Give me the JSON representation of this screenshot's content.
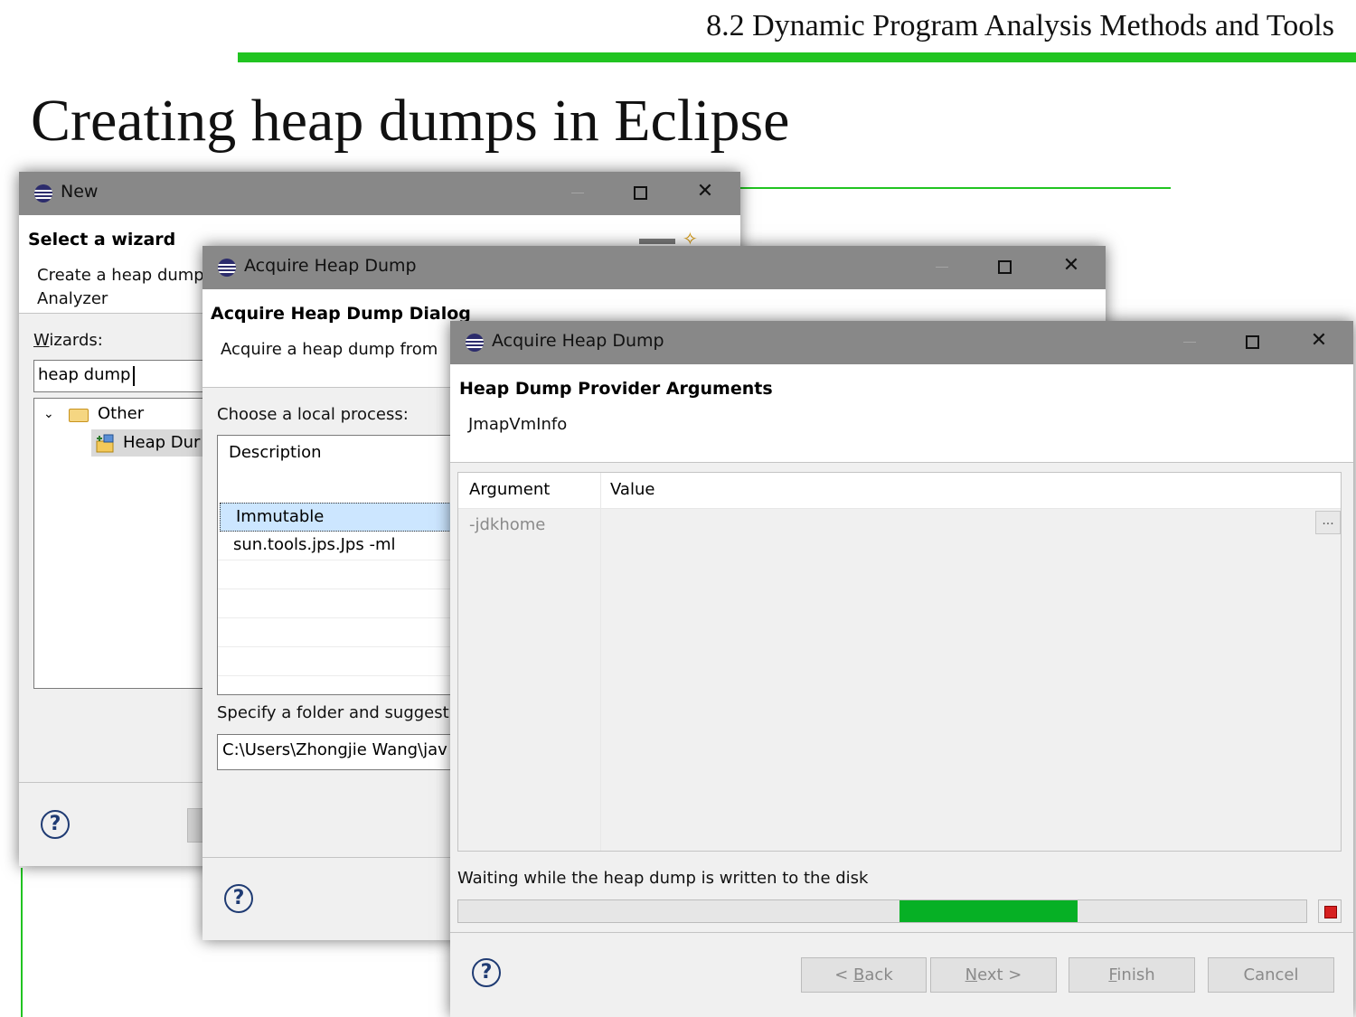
{
  "slide": {
    "section_header": "8.2 Dynamic Program Analysis Methods and Tools",
    "title": "Creating heap dumps in Eclipse"
  },
  "colors": {
    "accent_green": "#21c421",
    "titlebar": "#888888",
    "progress": "#06b025"
  },
  "new_window": {
    "title": "New",
    "heading": "Select a wizard",
    "description_line1": "Create a heap dump",
    "description_line2": "Analyzer",
    "wizards_label": "Wizards:",
    "filter_value": "heap dump",
    "tree": [
      {
        "label": "Other",
        "icon": "folder-icon",
        "expanded": true
      },
      {
        "label": "Heap Dur",
        "icon": "heap-dump-wizard-icon",
        "selected": true
      }
    ],
    "help_label": "?"
  },
  "acquire_window_1": {
    "title": "Acquire Heap Dump",
    "heading": "Acquire Heap Dump Dialog",
    "description": "Acquire a heap dump from",
    "choose_label": "Choose a local process:",
    "column_header": "Description",
    "processes": [
      {
        "label": "Immutable",
        "selected": true
      },
      {
        "label": "sun.tools.jps.Jps -ml",
        "selected": false
      }
    ],
    "folder_label": "Specify a folder and suggest",
    "folder_value": "C:\\Users\\Zhongjie Wang\\jav",
    "help_label": "?"
  },
  "acquire_window_2": {
    "title": "Acquire Heap Dump",
    "heading": "Heap Dump Provider Arguments",
    "provider": "JmapVmInfo",
    "table": {
      "headers": [
        "Argument",
        "Value"
      ],
      "rows": [
        {
          "argument": "-jdkhome",
          "value": ""
        }
      ],
      "browse_label": "..."
    },
    "status": "Waiting while the heap dump is written to the disk",
    "progress": {
      "start_fraction": 0.52,
      "end_fraction": 0.73
    },
    "buttons": {
      "back_prefix": "< ",
      "back_key": "B",
      "back_rest": "ack",
      "next_key": "N",
      "next_rest": "ext >",
      "finish_key": "F",
      "finish_rest": "inish",
      "cancel": "Cancel"
    },
    "help_label": "?"
  }
}
